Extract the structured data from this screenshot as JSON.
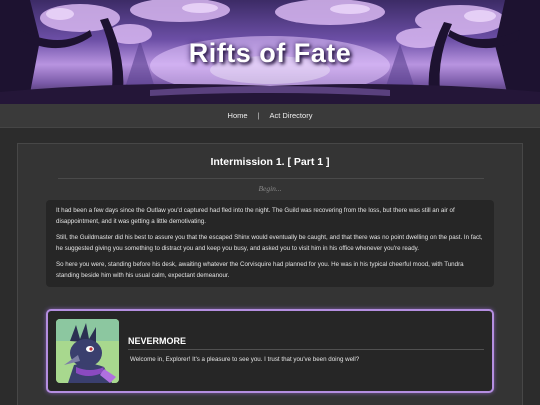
{
  "site": {
    "title": "Rifts of Fate"
  },
  "nav": {
    "home_label": "Home",
    "separator": "|",
    "act_directory_label": "Act Directory"
  },
  "page": {
    "title": "Intermission 1. [ Part 1 ]",
    "begin_label": "Begin..."
  },
  "narration": [
    "It had been a few days since the Outlaw you'd captured had fled into the night. The Guild was recovering from the loss, but there was still an air of disappointment, and it was getting a little demotivating.",
    "Still, the Guildmaster did his best to assure you that the escaped Shinx would eventually be caught, and that there was no point dwelling on the past. In fact, he suggested giving you something to distract you and keep you busy, and asked you to visit him in his office whenever you're ready.",
    "So here you were, standing before his desk, awaiting whatever the Corvisquire had planned for you. He was in his typical cheerful mood, with Tundra standing beside him with his usual calm, expectant demeanour."
  ],
  "dialogue": {
    "speaker": "NEVERMORE",
    "text": "Welcome in, Explorer! It's a pleasure to see you. I trust that you've been doing well?"
  },
  "colors": {
    "accent": "#b48ee0",
    "background": "#2c2c2c",
    "panel": "#343434",
    "text_box": "#262626"
  }
}
